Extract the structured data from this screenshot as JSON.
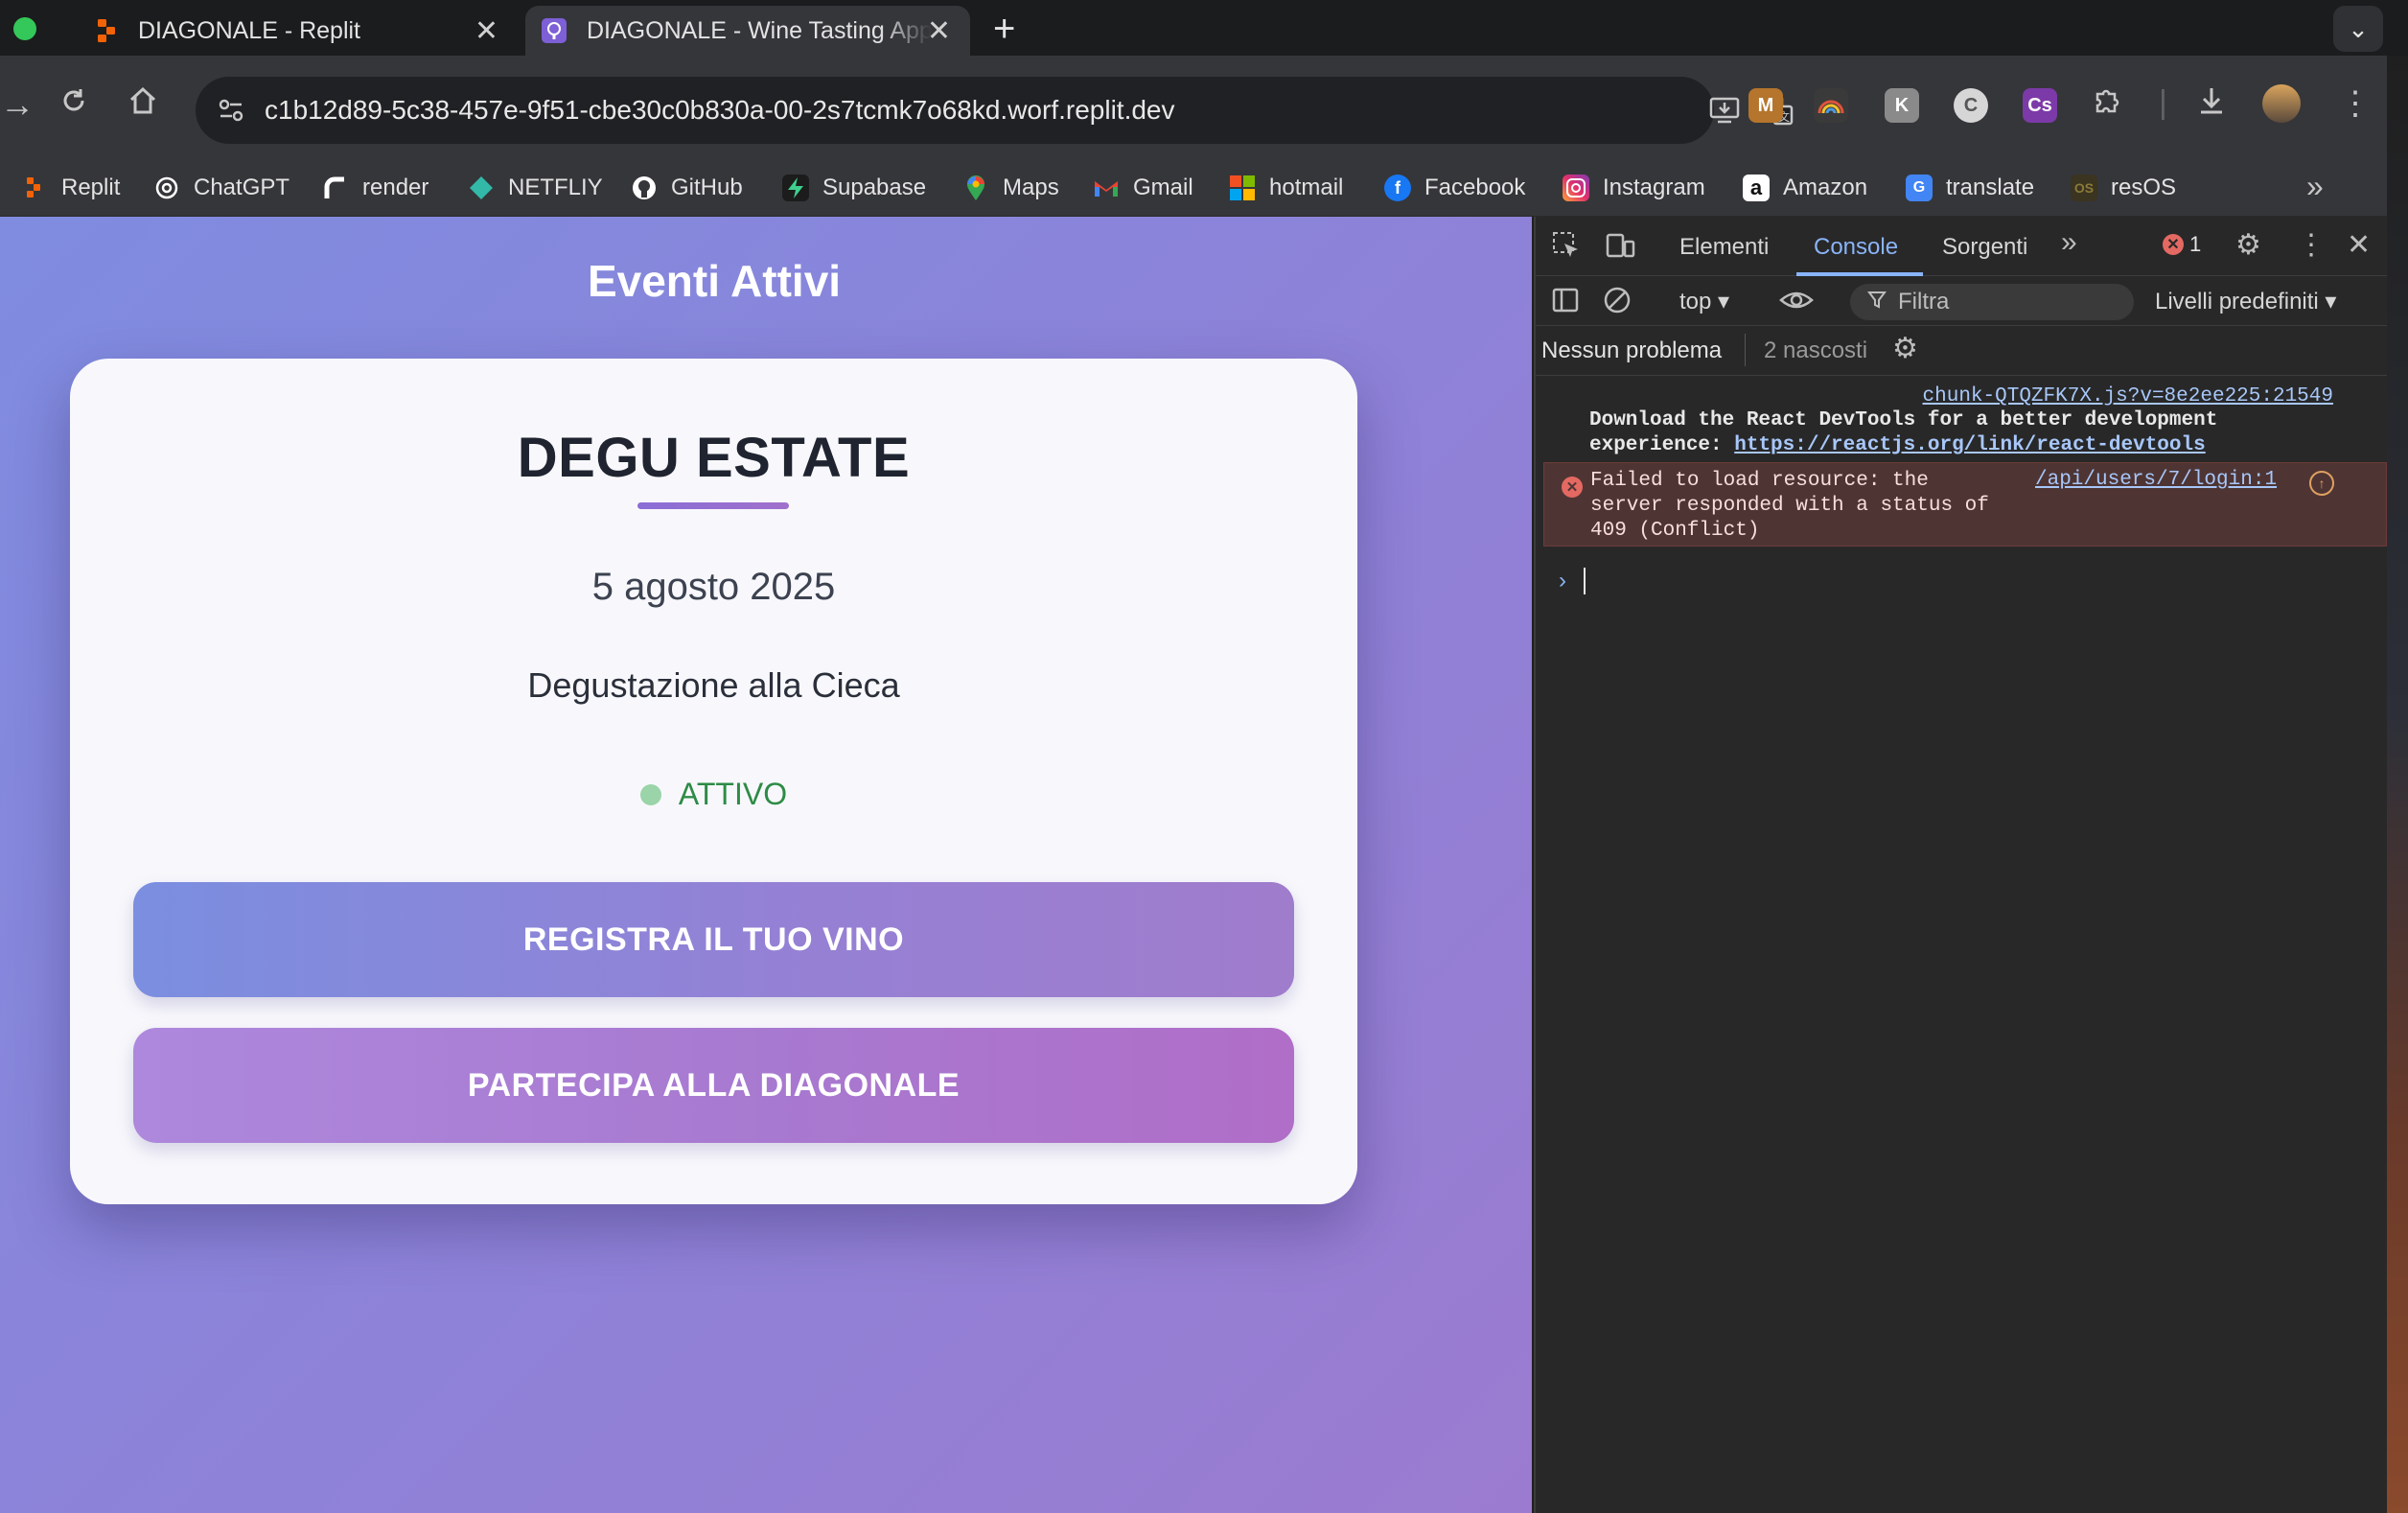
{
  "browser": {
    "tabs": [
      {
        "title": "DIAGONALE - Replit",
        "active": false
      },
      {
        "title": "DIAGONALE - Wine Tasting App",
        "active": true
      }
    ],
    "url": "c1b12d89-5c38-457e-9f51-cbe30c0b830a-00-2s7tcmk7o68kd.worf.replit.dev",
    "bookmarks": [
      {
        "label": "Replit",
        "icon": "replit-icon",
        "color": "#f26207"
      },
      {
        "label": "ChatGPT",
        "icon": "openai-icon",
        "color": "#ffffff"
      },
      {
        "label": "render",
        "icon": "render-icon",
        "color": "#ffffff"
      },
      {
        "label": "NETFLIY",
        "icon": "netlify-icon",
        "color": "#32b9a8"
      },
      {
        "label": "GitHub",
        "icon": "github-icon",
        "color": "#ffffff"
      },
      {
        "label": "Supabase",
        "icon": "supabase-icon",
        "color": "#3ecf8e"
      },
      {
        "label": "Maps",
        "icon": "maps-pin-icon",
        "color": "#ea4335"
      },
      {
        "label": "Gmail",
        "icon": "gmail-icon",
        "color": "#ea4335"
      },
      {
        "label": "hotmail",
        "icon": "microsoft-icon",
        "color": "#f25022"
      },
      {
        "label": "Facebook",
        "icon": "facebook-icon",
        "color": "#1877f2"
      },
      {
        "label": "Instagram",
        "icon": "instagram-icon",
        "color": "#e1306c"
      },
      {
        "label": "Amazon",
        "icon": "amazon-icon",
        "color": "#ffffff"
      },
      {
        "label": "translate",
        "icon": "translate-icon",
        "color": "#4285f4"
      },
      {
        "label": "resOS",
        "icon": "resos-icon",
        "color": "#8a7a3a"
      }
    ]
  },
  "page": {
    "heading": "Eventi Attivi",
    "event": {
      "name": "DEGU ESTATE",
      "date": "5 agosto 2025",
      "type": "Degustazione alla Cieca",
      "status": "ATTIVO",
      "status_color": "#2e8b47"
    },
    "buttons": {
      "register": "REGISTRA IL TUO VINO",
      "join": "PARTECIPA ALLA DIAGONALE"
    }
  },
  "devtools": {
    "tabs": [
      "Elementi",
      "Console",
      "Sorgenti"
    ],
    "active_tab": "Console",
    "error_count": "1",
    "context": "top",
    "filter_placeholder": "Filtra",
    "levels": "Livelli predefiniti",
    "issues": "Nessun problema",
    "hidden": "2 nascosti",
    "messages": {
      "info_source": "chunk-QTQZFK7X.js?v=8e2ee225:21549",
      "info_text": "Download the React DevTools for a better development experience: ",
      "info_link": "https://reactjs.org/link/react-devtools",
      "error_text": "Failed to load resource: the server responded with a status of 409 (Conflict)",
      "error_source": "/api/users/7/login:1"
    }
  }
}
